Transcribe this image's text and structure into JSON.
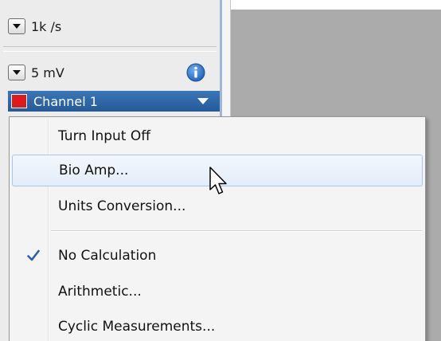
{
  "panel": {
    "sample_rate": "1k /s",
    "range": "5 mV",
    "channel": {
      "label": "Channel 1",
      "color": "#e0191d"
    }
  },
  "icons": {
    "dropdown": "chevron-down-icon",
    "info": "info-icon",
    "check": "check-icon",
    "cursor": "mouse-pointer-icon"
  },
  "colors": {
    "accent": "#2b62a3",
    "info_blue": "#2a73c8",
    "check_blue": "#2f5faa",
    "workspace": "#ababab"
  },
  "menu": {
    "items": [
      {
        "label": "Turn Input Off",
        "checked": false
      },
      {
        "label": "Bio Amp...",
        "checked": false,
        "hovered": true
      },
      {
        "label": "Units Conversion...",
        "checked": false
      },
      {
        "label": "No Calculation",
        "checked": true
      },
      {
        "label": "Arithmetic...",
        "checked": false
      },
      {
        "label": "Cyclic Measurements...",
        "checked": false
      }
    ]
  }
}
